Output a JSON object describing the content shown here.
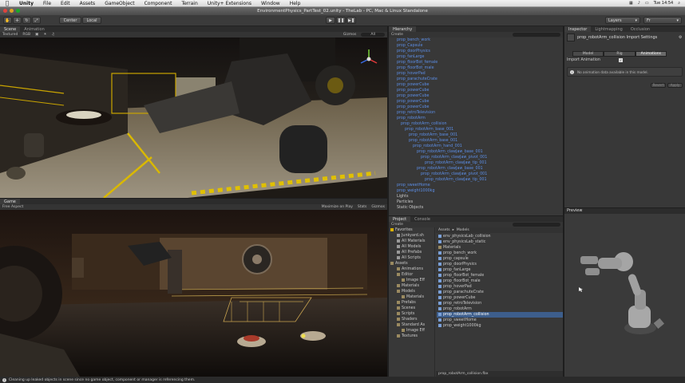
{
  "menubar": {
    "items": [
      "Unity",
      "File",
      "Edit",
      "Assets",
      "GameObject",
      "Component",
      "Terrain",
      "Unity+ Extensions",
      "Window",
      "Help"
    ],
    "clock": "Tue 14:54"
  },
  "window": {
    "title": "EnvironmentPhysics_PartTest_02.unity - TheLab - PC, Mac & Linux Standalone"
  },
  "toolbar": {
    "center": "Center",
    "local": "Local",
    "layers": "Layers",
    "layout": "Fr"
  },
  "scene": {
    "tabs": [
      "Scene",
      "Animation"
    ],
    "shading": "Textured",
    "mode": "RGB",
    "gizmos": "Gizmos",
    "search": "All"
  },
  "game": {
    "tabs": [
      "Game"
    ],
    "aspect": "Free Aspect",
    "max": "Maximize on Play",
    "stats": "Stats",
    "gizmos": "Gizmos"
  },
  "hierarchy": {
    "tab": "Hierarchy",
    "create": "Create",
    "items": [
      {
        "label": "prop_bench_work",
        "c": "blue",
        "d": 0
      },
      {
        "label": "prop_Capsule",
        "c": "blue",
        "d": 0
      },
      {
        "label": "prop_doorPhysics",
        "c": "blue",
        "d": 0
      },
      {
        "label": "prop_fanLarge",
        "c": "blue",
        "d": 0
      },
      {
        "label": "prop_floorBot_female",
        "c": "blue",
        "d": 0
      },
      {
        "label": "prop_floorBot_male",
        "c": "blue",
        "d": 0
      },
      {
        "label": "prop_hoverPad",
        "c": "blue",
        "d": 0
      },
      {
        "label": "prop_parachuteCrate",
        "c": "blue",
        "d": 0
      },
      {
        "label": "prop_powerCube",
        "c": "blue",
        "d": 0
      },
      {
        "label": "prop_powerCube",
        "c": "blue",
        "d": 0
      },
      {
        "label": "prop_powerCube",
        "c": "blue",
        "d": 0
      },
      {
        "label": "prop_powerCube",
        "c": "blue",
        "d": 0
      },
      {
        "label": "prop_powerCube",
        "c": "blue",
        "d": 0
      },
      {
        "label": "prop_retroTelevision",
        "c": "blue",
        "d": 0
      },
      {
        "label": "prop_robotArm",
        "c": "blue",
        "d": 0
      },
      {
        "label": "prop_robotArm_collision",
        "c": "blue",
        "d": 1
      },
      {
        "label": "prop_robotArm_base_001",
        "c": "blue",
        "d": 2
      },
      {
        "label": "prop_robotArm_base_001",
        "c": "blue",
        "d": 3
      },
      {
        "label": "prop_robotArm_base_001",
        "c": "blue",
        "d": 3
      },
      {
        "label": "prop_robotArm_hand_001",
        "c": "blue",
        "d": 4
      },
      {
        "label": "prop_robotArm_clawJaw_base_001",
        "c": "blue",
        "d": 5
      },
      {
        "label": "prop_robotArm_clawJaw_pivot_001",
        "c": "blue",
        "d": 6
      },
      {
        "label": "prop_robotArm_clawJaw_tip_001",
        "c": "blue",
        "d": 7
      },
      {
        "label": "prop_robotArm_clawJaw_base_001",
        "c": "blue",
        "d": 5
      },
      {
        "label": "prop_robotArm_clawJaw_pivot_001",
        "c": "blue",
        "d": 6
      },
      {
        "label": "prop_robotArm_clawJaw_tip_001",
        "c": "blue",
        "d": 7
      },
      {
        "label": "prop_sweetHome",
        "c": "blue",
        "d": 0
      },
      {
        "label": "prop_weight1000kg",
        "c": "blue",
        "d": 0
      },
      {
        "label": "Lights",
        "c": "white",
        "d": 0
      },
      {
        "label": "Particles",
        "c": "white",
        "d": 0
      },
      {
        "label": "Static Objects",
        "c": "white",
        "d": 0
      }
    ]
  },
  "project": {
    "tabs": [
      "Project",
      "Console"
    ],
    "create": "Create",
    "favorites_label": "Favorites",
    "favorites": [
      "Junkyard.sh",
      "All Materials",
      "All Models",
      "All Prefabs",
      "All Scripts"
    ],
    "assets_label": "Assets",
    "folders": [
      {
        "label": "Animations",
        "d": 1
      },
      {
        "label": "Editor",
        "d": 1
      },
      {
        "label": "Image Eff",
        "d": 2
      },
      {
        "label": "Materials",
        "d": 1
      },
      {
        "label": "Models",
        "d": 1
      },
      {
        "label": "Materials",
        "d": 2
      },
      {
        "label": "Prefabs",
        "d": 1
      },
      {
        "label": "Scenes",
        "d": 1
      },
      {
        "label": "Scripts",
        "d": 1
      },
      {
        "label": "Shaders",
        "d": 1
      },
      {
        "label": "Standard As",
        "d": 1
      },
      {
        "label": "Image Eff",
        "d": 2
      },
      {
        "label": "Textures",
        "d": 1
      }
    ],
    "path": [
      "Assets",
      "Models"
    ],
    "files": [
      "env_physicsLab_collision",
      "env_physicsLab_static",
      "Materials",
      "prop_bench_work",
      "prop_capsule",
      "prop_doorPhysics",
      "prop_fanLarge",
      "prop_floorBot_female",
      "prop_floorBot_male",
      "prop_hoverPad",
      "prop_parachuteCrate",
      "prop_powerCube",
      "prop_retroTelevision",
      "prop_robotArm",
      "prop_robotArm_collision",
      "prop_sweetHome",
      "prop_weight1000kg"
    ],
    "selected_file": "prop_robotArm_collision",
    "footer": "prop_robotArm_collision.fbx"
  },
  "inspector": {
    "tabs": [
      "Inspector",
      "Lightmapping",
      "Occlusion"
    ],
    "title": "prop_robotArm_collision Import Settings",
    "subtabs": [
      "Model",
      "Rig",
      "Animations"
    ],
    "import_animation": "Import Animation",
    "info": "No animation data available in this model.",
    "revert": "Revert",
    "apply": "Apply"
  },
  "preview": {
    "label": "Preview"
  },
  "status": {
    "message": "Cleaning up leaked objects in scene since no game object, component or manager is referencing them."
  },
  "colors": {
    "selection": "#3d5e8c",
    "prefab_blue": "#5c8ee6",
    "hazard": "#c9a400"
  }
}
